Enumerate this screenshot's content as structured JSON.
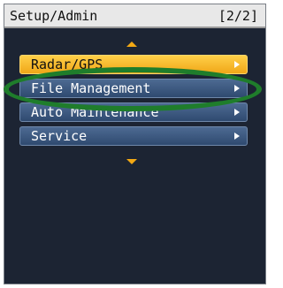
{
  "header": {
    "title": "Setup/Admin",
    "page_indicator": "[2/2]"
  },
  "menu": {
    "items": [
      {
        "label": "Radar/GPS",
        "state": "selected"
      },
      {
        "label": "File Management",
        "state": "normal"
      },
      {
        "label": "Auto Maintenance",
        "state": "normal"
      },
      {
        "label": "Service",
        "state": "normal"
      }
    ]
  },
  "icons": {
    "scroll_up": "up-arrow-icon",
    "scroll_down": "down-arrow-icon",
    "item_chevron": "chevron-right-icon"
  },
  "colors": {
    "screen_background": "#1c2433",
    "selected_item": "#f2a814",
    "normal_item": "#3f5a82",
    "annotation_oval": "#1f7d2b"
  }
}
